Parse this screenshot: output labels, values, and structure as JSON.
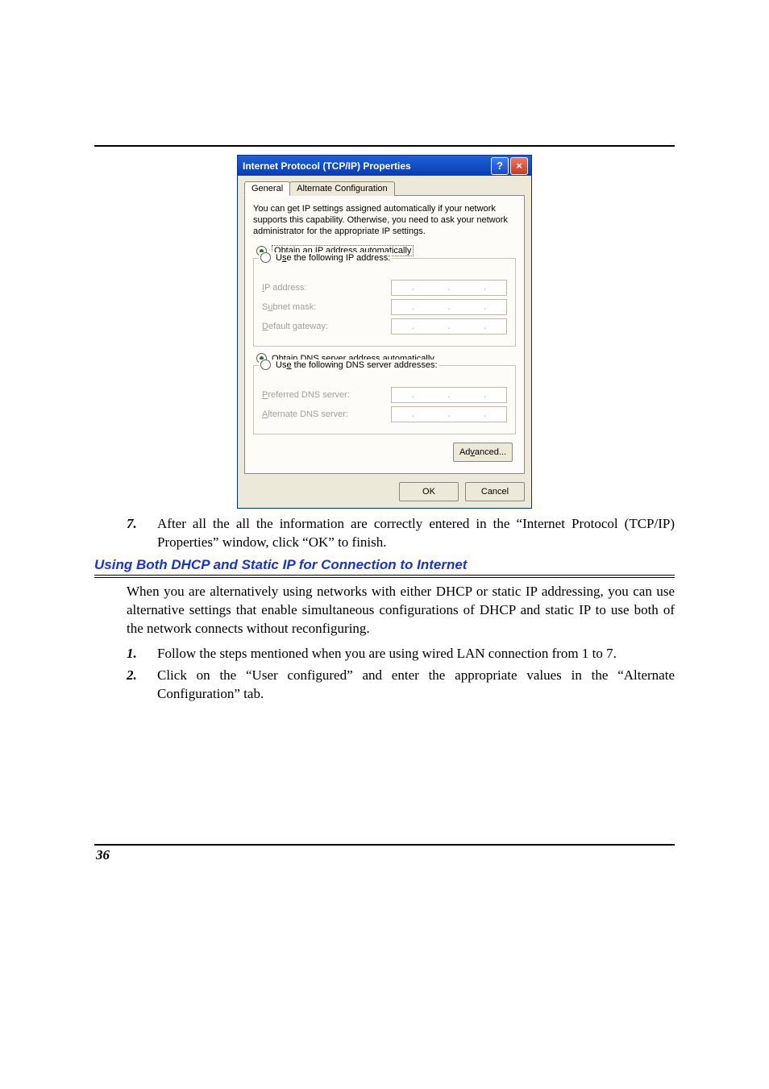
{
  "dialog": {
    "title": "Internet Protocol (TCP/IP) Properties",
    "help_icon": "?",
    "close_icon": "×",
    "tabs": {
      "general": "General",
      "alternate": "Alternate Configuration"
    },
    "intro": "You can get IP settings assigned automatically if your network supports this capability. Otherwise, you need to ask your network administrator for the appropriate IP settings.",
    "radios": {
      "obtain_ip": "Obtain an IP address automatically",
      "use_ip": "Use the following IP address:",
      "obtain_dns": "Obtain DNS server address automatically",
      "use_dns": "Use the following DNS server addresses:"
    },
    "labels": {
      "ip": "IP address:",
      "subnet": "Subnet mask:",
      "gateway": "Default gateway:",
      "pref_dns": "Preferred DNS server:",
      "alt_dns": "Alternate DNS server:"
    },
    "buttons": {
      "advanced": "Advanced...",
      "ok": "OK",
      "cancel": "Cancel"
    }
  },
  "doc": {
    "step7_num": "7.",
    "step7": "After all the all the information are correctly entered in the “Internet Protocol (TCP/IP) Properties” window, click “OK” to finish.",
    "heading": "Using Both DHCP and Static IP for Connection to Internet",
    "para": "When you are alternatively using networks with either DHCP or static IP addressing, you can use alternative settings that enable simultaneous configurations of DHCP and static IP to use both of the network connects without reconfiguring.",
    "step1_num": "1.",
    "step1": "Follow the steps mentioned when you are using wired LAN connection from 1 to 7.",
    "step2_num": "2.",
    "step2": "Click on the “User configured” and enter the appropriate values in the “Alternate Configuration” tab.",
    "page_number": "36"
  }
}
